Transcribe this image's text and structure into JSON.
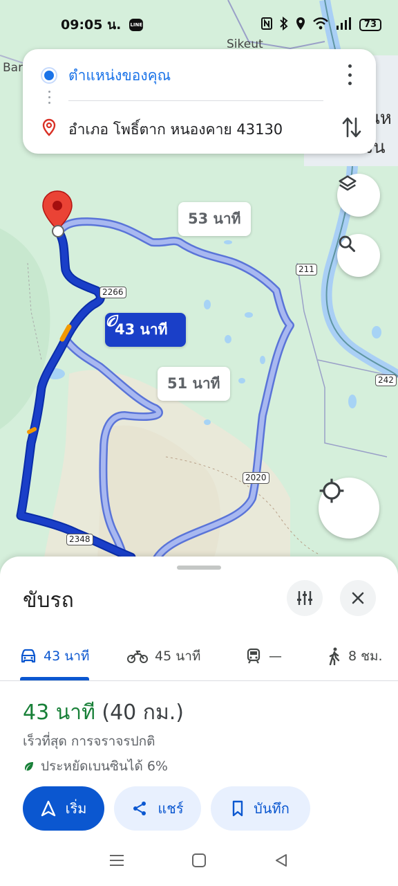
{
  "status_bar": {
    "time": "09:05 น.",
    "line_badge": "LINE",
    "battery": "73"
  },
  "map": {
    "place_labels": [
      "Sikeut",
      "Bar",
      "นห",
      "งจัน"
    ],
    "road_shields": [
      "2266",
      "211",
      "242",
      "2020",
      "2348"
    ],
    "route_bubbles": {
      "primary": "43 นาที",
      "alt1": "53 นาที",
      "alt2": "51 นาที"
    },
    "route_colors": {
      "primary": "#1a3fc8",
      "alternate": "#a8b8f0",
      "traffic_slow": "#f29900"
    }
  },
  "search_card": {
    "origin": "ตำแหน่งของคุณ",
    "destination": "อำเภอ โพธิ์ตาก หนองคาย 43130"
  },
  "sheet": {
    "title": "ขับรถ",
    "modes": [
      {
        "icon": "car-icon",
        "label": "43 นาที",
        "active": true
      },
      {
        "icon": "motorcycle-icon",
        "label": "45 นาที",
        "active": false
      },
      {
        "icon": "train-icon",
        "label": "—",
        "active": false
      },
      {
        "icon": "walk-icon",
        "label": "8 ชม.",
        "active": false
      }
    ],
    "summary": {
      "duration": "43 นาที",
      "distance": "(40 กม.)",
      "subtitle": "เร็วที่สุด การจราจรปกติ",
      "eco": "ประหยัดเบนซินได้ 6%"
    },
    "actions": {
      "start": "เริ่ม",
      "share": "แชร์",
      "save": "บันทึก"
    }
  },
  "colors": {
    "accent": "#0b57d0",
    "duration_green": "#188038"
  }
}
